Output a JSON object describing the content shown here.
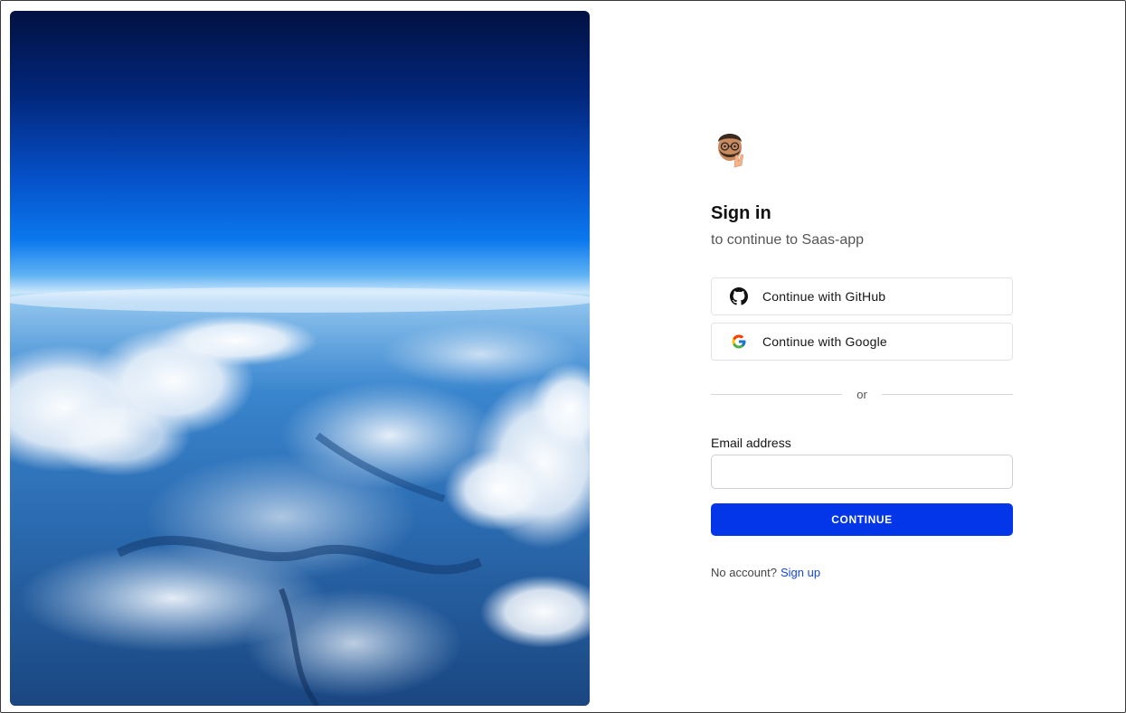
{
  "auth": {
    "title": "Sign in",
    "subtitle": "to continue to Saas-app",
    "social": [
      {
        "provider": "github",
        "label": "Continue with GitHub",
        "icon": "github-icon"
      },
      {
        "provider": "google",
        "label": "Continue with Google",
        "icon": "google-icon"
      }
    ],
    "divider_text": "or",
    "email": {
      "label": "Email address",
      "value": "",
      "placeholder": ""
    },
    "continue_label": "CONTINUE",
    "footer": {
      "prompt": "No account?",
      "link_label": "Sign up"
    }
  },
  "colors": {
    "primary": "#0336e8",
    "link": "#1746e0",
    "sky_top": "#02164a",
    "sky_mid": "#0b6fe6",
    "horizon": "#9fd0f7"
  },
  "hero_image": "aerial-snowy-mountains-clouds"
}
